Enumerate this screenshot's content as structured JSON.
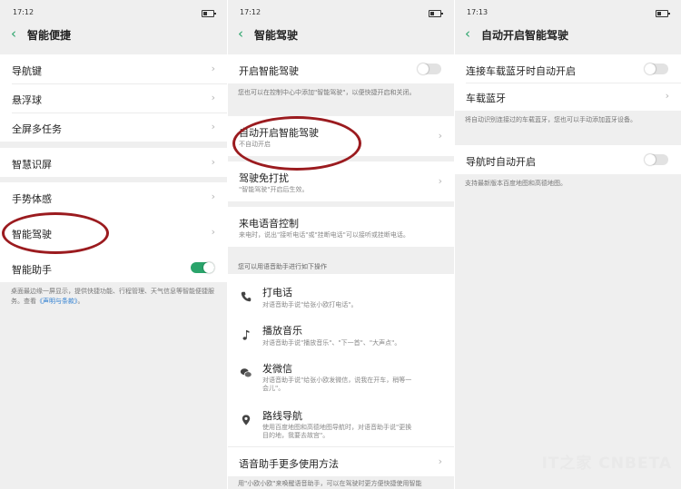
{
  "status": {
    "time1": "17:12",
    "time2": "17:12",
    "time3": "17:13"
  },
  "panel1": {
    "title": "智能便捷",
    "items": [
      {
        "label": "导航键"
      },
      {
        "label": "悬浮球"
      },
      {
        "label": "全屏多任务"
      },
      {
        "label": "智慧识屏"
      },
      {
        "label": "手势体感"
      },
      {
        "label": "智能驾驶"
      },
      {
        "label": "智能助手"
      }
    ],
    "note_text": "桌面最边缘一屏显示，提供快捷功能、行程管理、天气信息等智能便捷服务。查看",
    "note_link": "《声明与条款》",
    "note_end": "。",
    "assistant_toggle": true
  },
  "panel2": {
    "title": "智能驾驶",
    "enable_label": "开启智能驾驶",
    "enable_note": "您也可以在控制中心中添加\"智能驾驶\"，以便快捷开启和关闭。",
    "auto_label": "自动开启智能驾驶",
    "auto_sub": "不自动开启",
    "dnd_label": "驾驶免打扰",
    "dnd_sub": "\"智能驾驶\"开启后生效。",
    "call_label": "来电语音控制",
    "call_sub": "来电时，说出\"接听电话\"或\"挂断电话\"可以接听或挂断电话。",
    "section": "您可以用语音助手进行如下操作",
    "ops": [
      {
        "label": "打电话",
        "sub": "对语音助手说\"给张小欧打电话\"。"
      },
      {
        "label": "播放音乐",
        "sub": "对语音助手说\"播放音乐\"、\"下一首\"、\"大声点\"。"
      },
      {
        "label": "发微信",
        "sub": "对语音助手说\"给张小欧发微信，说我在开车，稍等一",
        "sub2": "会儿\"。"
      },
      {
        "label": "路线导航",
        "sub": "使用百度地图和高德地图导航时，对语音助手说\"更换",
        "sub2": "目的地，我要去故宫\"。"
      }
    ],
    "more_label": "语音助手更多使用方法",
    "bottom_note": "用\"小欧小欧\"来唤醒语音助手，可以在驾驶时更方便快捷使用智能"
  },
  "panel3": {
    "title": "自动开启智能驾驶",
    "bt_auto_label": "连接车载蓝牙时自动开启",
    "bt_label": "车载蓝牙",
    "bt_note": "将自动识别连接过的车载蓝牙，您也可以手动添加蓝牙设备。",
    "nav_label": "导航时自动开启",
    "nav_note": "支持最新版本百度地图和高德地图。"
  },
  "watermark": "IT之家  CNBETA",
  "colors": {
    "accent": "#2aa46b",
    "annotation": "#9b1b1f",
    "link": "#2f7fd1"
  }
}
